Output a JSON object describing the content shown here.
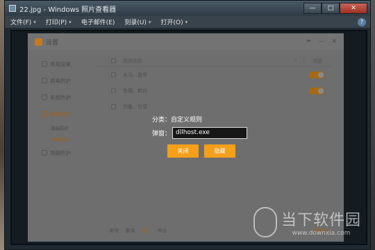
{
  "window": {
    "title": "22.jpg - Windows 照片查看器",
    "controls": [
      "—",
      "□",
      "✕"
    ]
  },
  "menu": {
    "items": [
      {
        "label": "文件(F)"
      },
      {
        "label": "打印(P)"
      },
      {
        "label": "电子邮件(E)"
      },
      {
        "label": "刻录(U)"
      },
      {
        "label": "打开(O)"
      }
    ],
    "help_glyph": "?"
  },
  "settings": {
    "title": "设置",
    "controls": [
      "⏷",
      "—",
      "✕"
    ],
    "sidebar": [
      {
        "label": "常规设置",
        "active": false
      },
      {
        "label": "病毒防护",
        "active": false
      },
      {
        "label": "系统防护",
        "active": false
      },
      {
        "label": "网络防护",
        "active": true
      },
      {
        "label": "基础防护",
        "sub": true,
        "active": false
      },
      {
        "label": "弹窗拦截",
        "sub": true,
        "active": true
      },
      {
        "label": "高级防护",
        "active": false
      }
    ],
    "rules_header": {
      "name": "规则名称",
      "sort": "⌃",
      "state": "状态"
    },
    "rules": [
      {
        "name": "木马、盗号"
      },
      {
        "name": "色情、欺诈"
      },
      {
        "name": "钓鱼、仿冒"
      }
    ],
    "footer": {
      "links": [
        "新增",
        "删除",
        "导入",
        "导出"
      ],
      "right": "恢复默认"
    }
  },
  "detail": {
    "category_label": "分类：",
    "category_value": "自定义规则",
    "popup_label": "弹窗：",
    "popup_value": "dllhost.exe",
    "close_button": "关闭",
    "block_button": "隐藏"
  },
  "watermark": {
    "main": "当下软件园",
    "url": "www.downxia.com"
  },
  "colors": {
    "accent": "#f4a01a"
  }
}
